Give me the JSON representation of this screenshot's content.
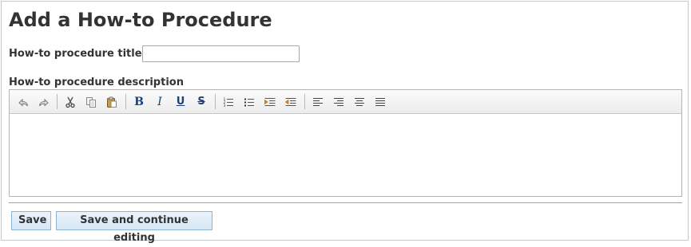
{
  "page": {
    "title": "Add a How-to Procedure"
  },
  "form": {
    "title_label": "How-to procedure title:",
    "title_value": "",
    "description_label": "How-to procedure description"
  },
  "toolbar": {
    "buttons": [
      {
        "icon": "undo-icon"
      },
      {
        "icon": "redo-icon"
      },
      {
        "icon": "cut-icon"
      },
      {
        "icon": "copy-icon"
      },
      {
        "icon": "paste-icon"
      },
      {
        "icon": "bold-icon",
        "glyph": "B"
      },
      {
        "icon": "italic-icon",
        "glyph": "I"
      },
      {
        "icon": "underline-icon",
        "glyph": "U"
      },
      {
        "icon": "strikethrough-icon",
        "glyph": "S"
      },
      {
        "icon": "ordered-list-icon"
      },
      {
        "icon": "unordered-list-icon"
      },
      {
        "icon": "indent-icon"
      },
      {
        "icon": "outdent-icon"
      },
      {
        "icon": "align-left-icon"
      },
      {
        "icon": "align-right-icon"
      },
      {
        "icon": "align-center-icon"
      },
      {
        "icon": "align-justify-icon"
      }
    ]
  },
  "actions": {
    "save_label": "Save",
    "save_continue_label": "Save and continue editing"
  },
  "colors": {
    "button_fill": "#dbe9f6",
    "button_border": "#8fb3d3",
    "icon_blue": "#1f3f7a",
    "accent_orange": "#e08a1e"
  }
}
